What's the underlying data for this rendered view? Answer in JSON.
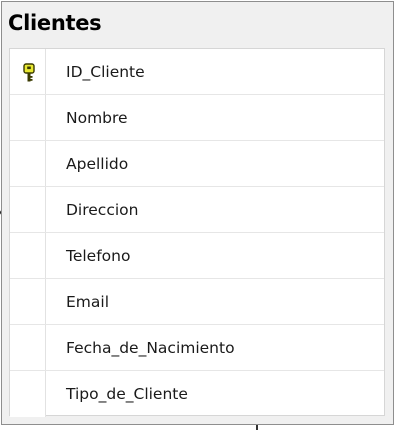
{
  "table": {
    "title": "Clientes",
    "columns": [
      {
        "name": "ID_Cliente",
        "primary_key": true,
        "icon": "primary-key-icon"
      },
      {
        "name": "Nombre",
        "primary_key": false
      },
      {
        "name": "Apellido",
        "primary_key": false
      },
      {
        "name": "Direccion",
        "primary_key": false
      },
      {
        "name": "Telefono",
        "primary_key": false
      },
      {
        "name": "Email",
        "primary_key": false
      },
      {
        "name": "Fecha_de_Nacimiento",
        "primary_key": false
      },
      {
        "name": "Tipo_de_Cliente",
        "primary_key": false
      }
    ]
  },
  "colors": {
    "border": "#8e8e8e",
    "header_bg": "#f0f0f0",
    "key_yellow": "#e8e832"
  }
}
